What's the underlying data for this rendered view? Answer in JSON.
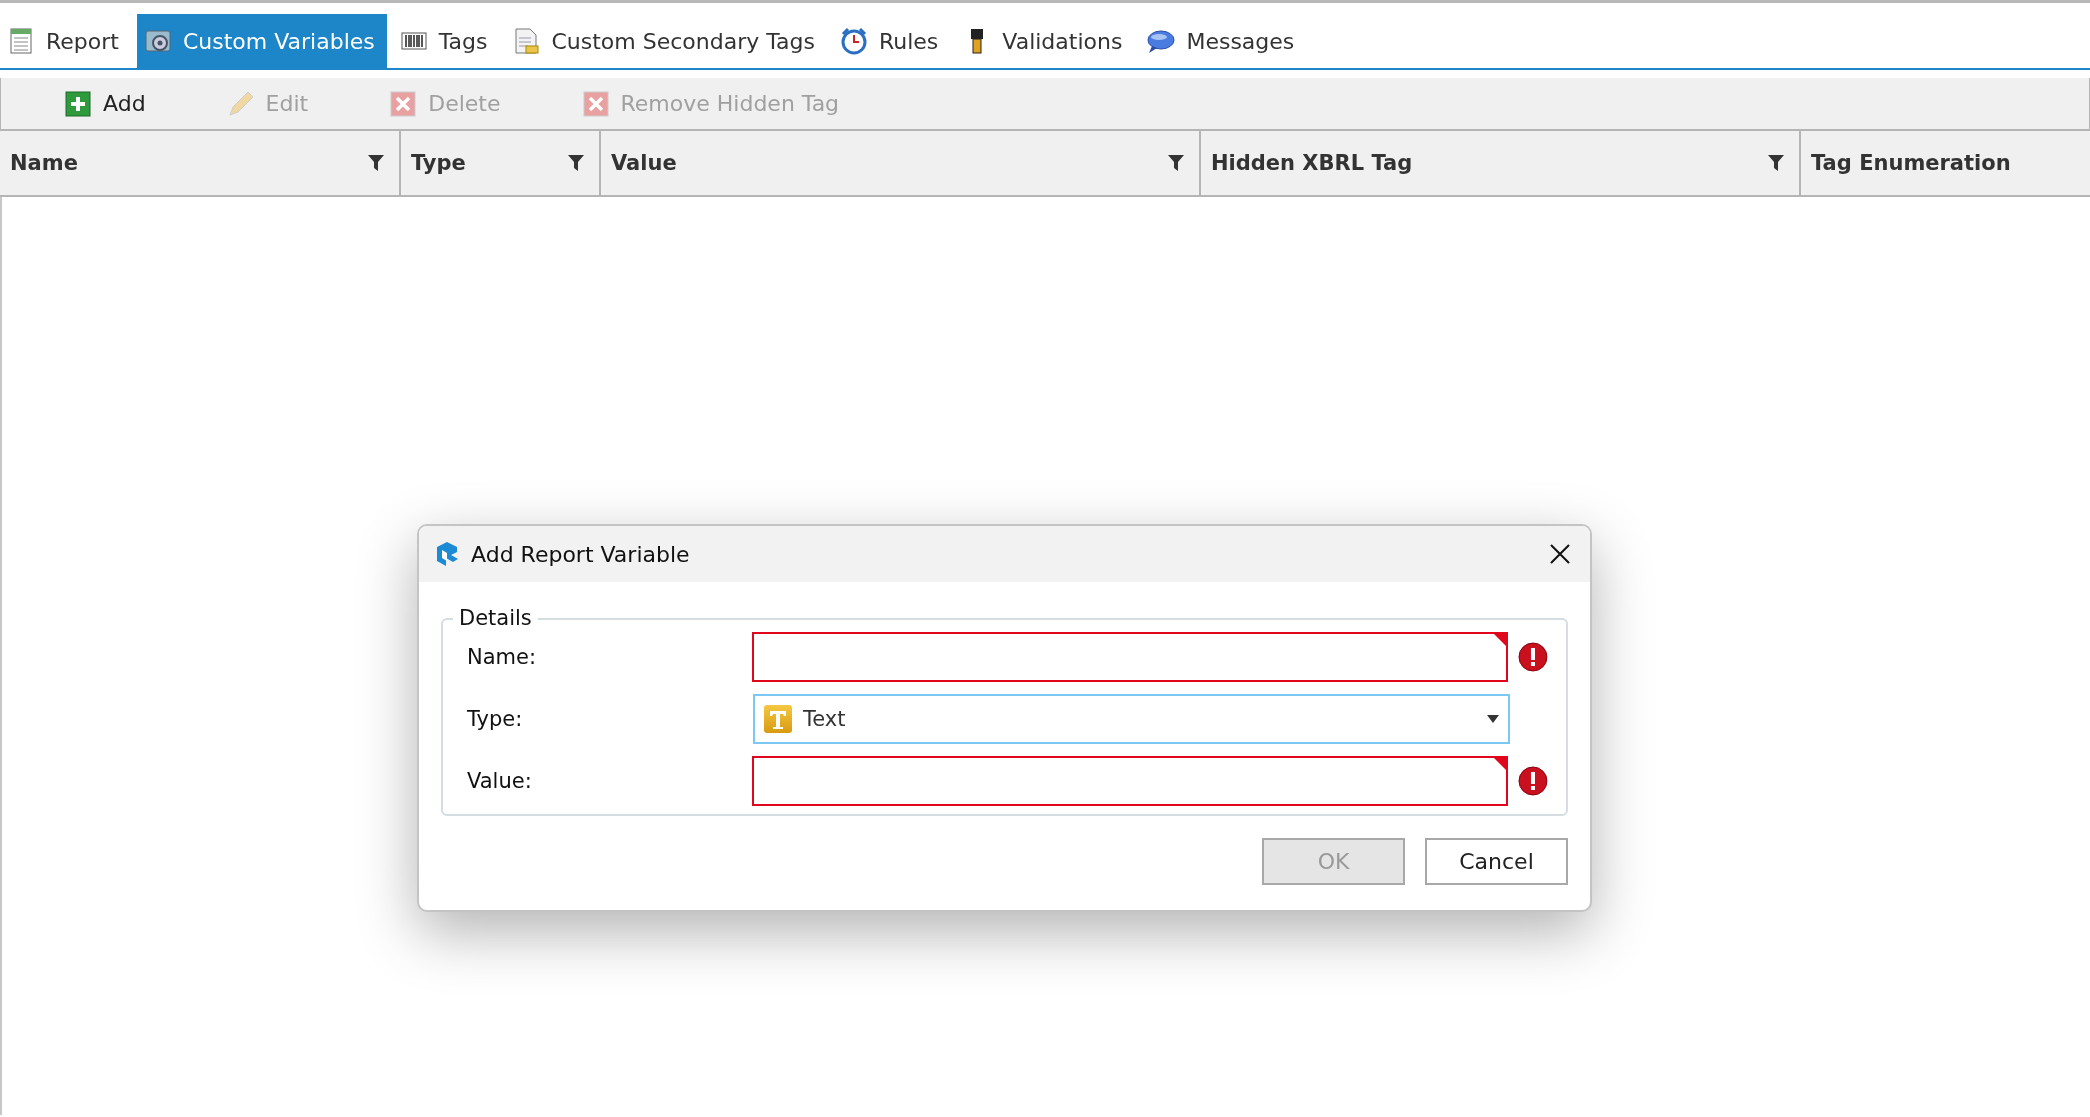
{
  "tabs": [
    {
      "label": "Report",
      "selected": false
    },
    {
      "label": "Custom Variables",
      "selected": true
    },
    {
      "label": "Tags",
      "selected": false
    },
    {
      "label": "Custom Secondary Tags",
      "selected": false
    },
    {
      "label": "Rules",
      "selected": false
    },
    {
      "label": "Validations",
      "selected": false
    },
    {
      "label": "Messages",
      "selected": false
    }
  ],
  "toolbar": [
    {
      "label": "Add",
      "disabled": false
    },
    {
      "label": "Edit",
      "disabled": true
    },
    {
      "label": "Delete",
      "disabled": true
    },
    {
      "label": "Remove Hidden Tag",
      "disabled": true
    }
  ],
  "table": {
    "columns": [
      {
        "label": "Name",
        "filter": true
      },
      {
        "label": "Type",
        "filter": true
      },
      {
        "label": "Value",
        "filter": true
      },
      {
        "label": "Hidden XBRL Tag",
        "filter": true
      },
      {
        "label": "Tag Enumeration",
        "filter": false
      }
    ]
  },
  "dialog": {
    "title": "Add Report Variable",
    "group": "Details",
    "fields": [
      {
        "label": "Name:",
        "kind": "text",
        "error": true
      },
      {
        "label": "Type:",
        "kind": "dropdown",
        "value": "Text",
        "error": false
      },
      {
        "label": "Value:",
        "kind": "text",
        "error": true
      }
    ],
    "buttons": [
      {
        "label": "OK",
        "disabled": true
      },
      {
        "label": "Cancel",
        "disabled": false
      }
    ]
  }
}
